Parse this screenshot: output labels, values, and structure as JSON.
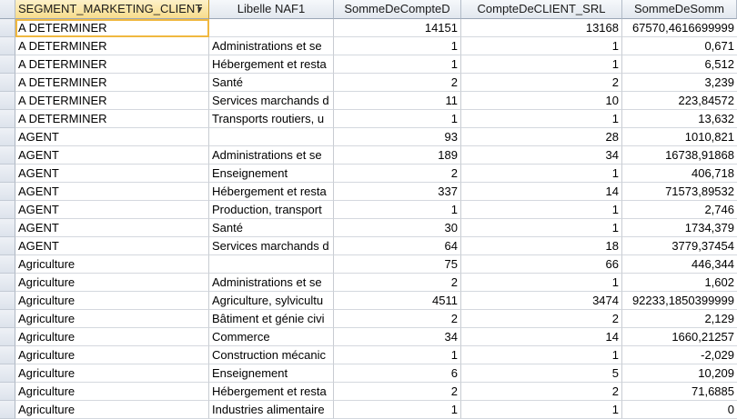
{
  "table": {
    "columns": [
      "SEGMENT_MARKETING_CLIENT",
      "Libelle NAF1",
      "SommeDeCompteD",
      "CompteDeCLIENT_SRL",
      "SommeDeSomm"
    ],
    "rows": [
      [
        "A DETERMINER",
        "",
        "14151",
        "13168",
        "67570,4616699999"
      ],
      [
        "A DETERMINER",
        "Administrations et se",
        "1",
        "1",
        "0,671"
      ],
      [
        "A DETERMINER",
        "Hébergement et resta",
        "1",
        "1",
        "6,512"
      ],
      [
        "A DETERMINER",
        "Santé",
        "2",
        "2",
        "3,239"
      ],
      [
        "A DETERMINER",
        "Services marchands d",
        "11",
        "10",
        "223,84572"
      ],
      [
        "A DETERMINER",
        "Transports routiers, u",
        "1",
        "1",
        "13,632"
      ],
      [
        "AGENT",
        "",
        "93",
        "28",
        "1010,821"
      ],
      [
        "AGENT",
        "Administrations et se",
        "189",
        "34",
        "16738,91868"
      ],
      [
        "AGENT",
        "Enseignement",
        "2",
        "1",
        "406,718"
      ],
      [
        "AGENT",
        "Hébergement et resta",
        "337",
        "14",
        "71573,89532"
      ],
      [
        "AGENT",
        "Production, transport",
        "1",
        "1",
        "2,746"
      ],
      [
        "AGENT",
        "Santé",
        "30",
        "1",
        "1734,379"
      ],
      [
        "AGENT",
        "Services marchands d",
        "64",
        "18",
        "3779,37454"
      ],
      [
        "Agriculture",
        "",
        "75",
        "66",
        "446,344"
      ],
      [
        "Agriculture",
        "Administrations et se",
        "2",
        "1",
        "1,602"
      ],
      [
        "Agriculture",
        "Agriculture, sylvicultu",
        "4511",
        "3474",
        "92233,1850399999"
      ],
      [
        "Agriculture",
        "Bâtiment et génie civi",
        "2",
        "2",
        "2,129"
      ],
      [
        "Agriculture",
        "Commerce",
        "34",
        "14",
        "1660,21257"
      ],
      [
        "Agriculture",
        "Construction mécanic",
        "1",
        "1",
        "-2,029"
      ],
      [
        "Agriculture",
        "Enseignement",
        "6",
        "5",
        "10,209"
      ],
      [
        "Agriculture",
        "Hébergement et resta",
        "2",
        "2",
        "71,6885"
      ],
      [
        "Agriculture",
        "Industries alimentaire",
        "1",
        "1",
        "0"
      ]
    ]
  },
  "icons": {
    "sort_dropdown": "chevron-down-icon"
  }
}
